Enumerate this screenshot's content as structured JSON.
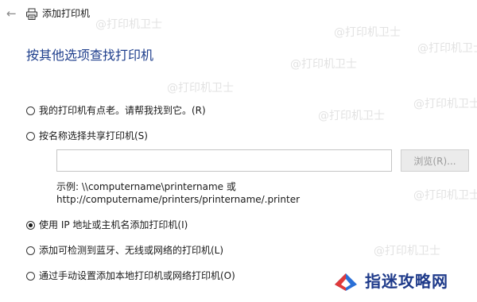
{
  "window": {
    "title": "添加打印机"
  },
  "page": {
    "heading": "按其他选项查找打印机"
  },
  "options": [
    {
      "label": "我的打印机有点老。请帮我找到它。(R)",
      "checked": false
    },
    {
      "label": "按名称选择共享打印机(S)",
      "checked": false
    },
    {
      "label": "使用 IP 地址或主机名添加打印机(I)",
      "checked": true
    },
    {
      "label": "添加可检测到蓝牙、无线或网络的打印机(L)",
      "checked": false
    },
    {
      "label": "通过手动设置添加本地打印机或网络打印机(O)",
      "checked": false
    }
  ],
  "shared_printer": {
    "input_value": "",
    "browse_label": "浏览(R)...",
    "example_line1": "示例: \\\\computername\\printername 或",
    "example_line2": "http://computername/printers/printername/.printer"
  },
  "watermark": {
    "text": "@打印机卫士"
  },
  "site_logo": {
    "text": "指迷攻略网"
  },
  "icons": {
    "back": "back-arrow-icon",
    "printer": "printer-icon",
    "logo": "logo-mark-icon"
  },
  "colors": {
    "heading": "#1e3e8c",
    "logo_text": "#1e3a8a",
    "logo_red": "#e03a3a",
    "logo_blue": "#2a6fd6"
  }
}
